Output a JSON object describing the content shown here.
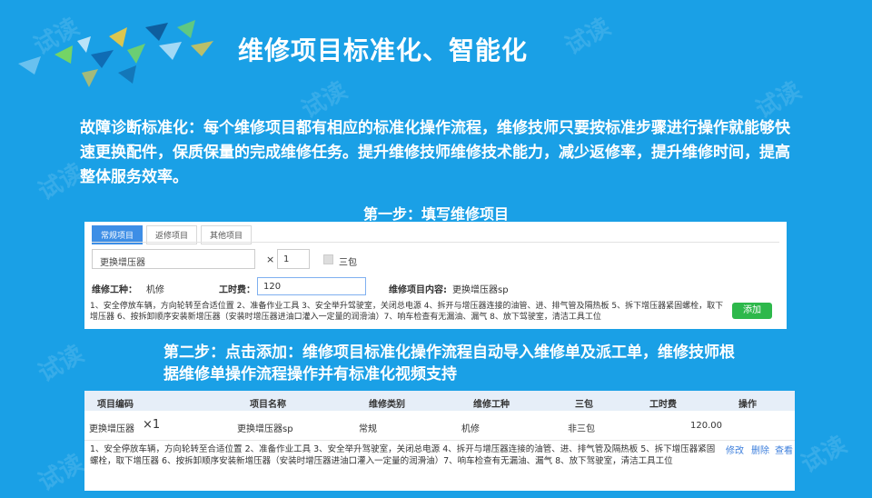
{
  "slide": {
    "title": "维修项目标准化、智能化",
    "description": "故障诊断标准化：每个维修项目都有相应的标准化操作流程，维修技师只要按标准步骤进行操作就能够快速更换配件，保质保量的完成维修任务。提升维修技师维修技术能力，减少返修率，提升维修时间，提高整体服务效率。",
    "step1_heading": "第一步：填写维修项目",
    "step2_heading": "第二步：点击添加：维修项目标准化操作流程自动导入维修单及派工单，维修技师根据维修单操作流程操作并有标准化视频支持",
    "watermark": "试读"
  },
  "form": {
    "tabs": [
      "常规项目",
      "返修项目",
      "其他项目"
    ],
    "active_tab": 0,
    "item_value": "更换增压器",
    "times_sign": "×",
    "quantity": "1",
    "checkbox_label": "三包",
    "work_type_label": "维修工种：",
    "work_type_value": "机修",
    "hours_label": "工时费：",
    "hours_value": "120",
    "content_label": "维修项目内容:",
    "content_value": "更换增压器sp",
    "procedure": "1、安全停放车辆，方向轮转至合适位置 2、准备作业工具 3、安全举升驾驶室，关闭总电源 4、拆开与增压器连接的油管、进、排气管及隔热板 5、拆下增压器紧固螺栓，取下增压器 6、按拆卸顺序安装新增压器（安装时增压器进油口灌入一定量的润滑油）7、响车检查有无漏油、漏气 8、放下驾驶室，清洁工具工位",
    "add_button": "添加"
  },
  "table": {
    "headers": [
      "项目编码",
      "项目名称",
      "维修类别",
      "维修工种",
      "三包",
      "工时费",
      "操作"
    ],
    "row": {
      "code": "更换增压器",
      "qty": "×1",
      "name": "更换增压器sp",
      "category": "常规",
      "work_type": "机修",
      "warranty": "非三包",
      "fee": "120.00"
    },
    "procedure": "1、安全停放车辆，方向轮转至合适位置 2、准备作业工具 3、安全举升驾驶室，关闭总电源 4、拆开与增压器连接的油管、进、排气管及隔热板 5、拆下增压器紧固螺栓，取下增压器 6、按拆卸顺序安装新增压器（安装时增压器进油口灌入一定量的润滑油）7、响车检查有无漏油、漏气 8、放下驾驶室，清洁工具工位",
    "actions": [
      "修改",
      "删除",
      "查看"
    ]
  }
}
